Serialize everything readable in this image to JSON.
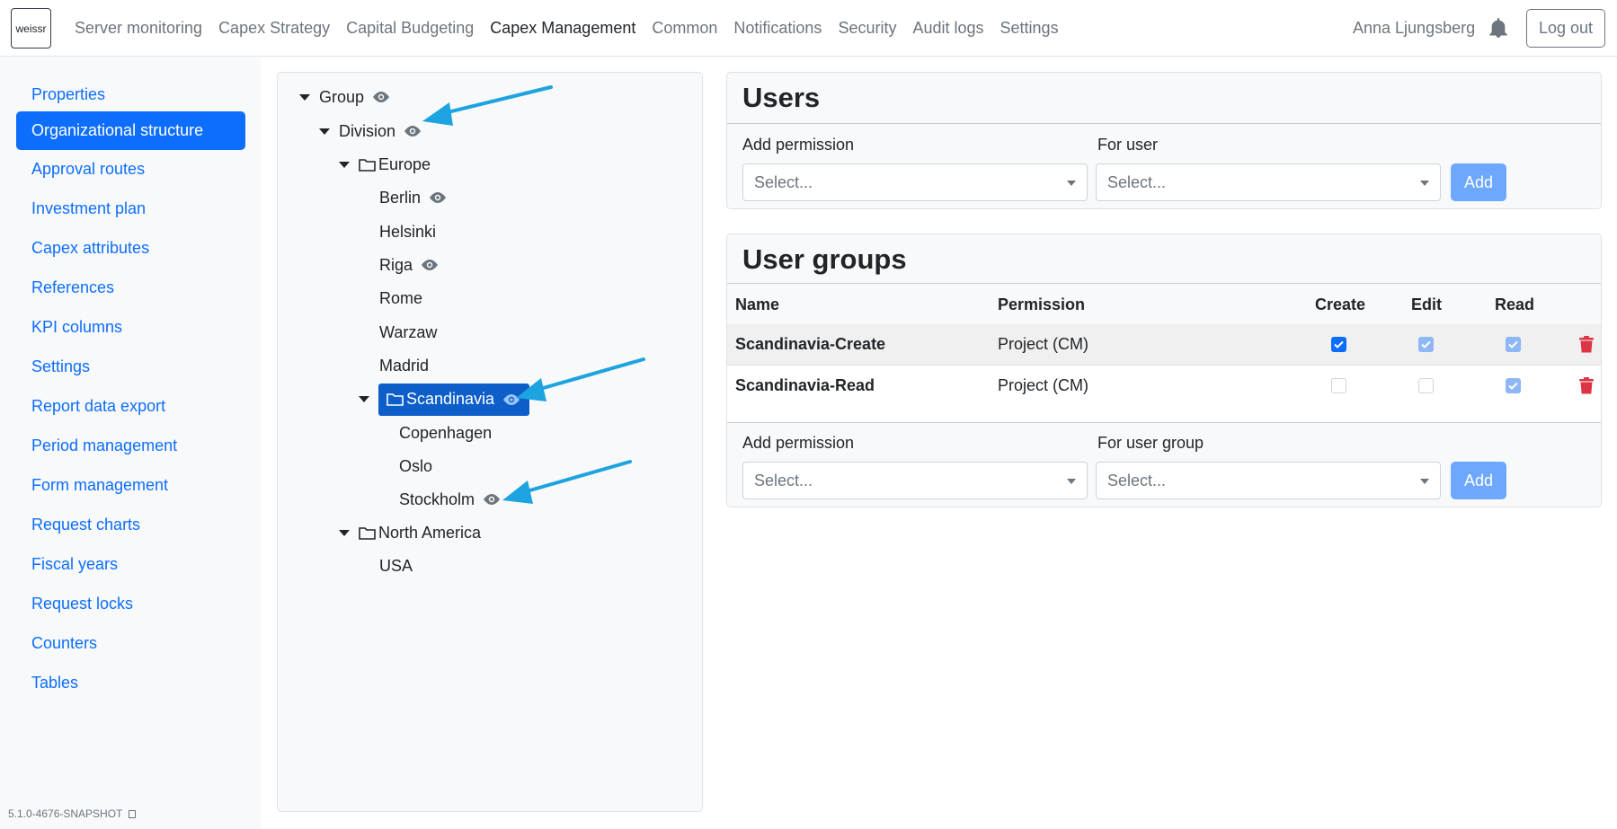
{
  "navbar": {
    "logo": "weissr",
    "items": [
      "Server monitoring",
      "Capex Strategy",
      "Capital Budgeting",
      "Capex Management",
      "Common",
      "Notifications",
      "Security",
      "Audit logs",
      "Settings"
    ],
    "active": "Capex Management",
    "user_name": "Anna Ljungsberg",
    "logout_label": "Log out"
  },
  "sidebar": {
    "items": [
      "Properties",
      "Organizational structure",
      "Approval routes",
      "Investment plan",
      "Capex attributes",
      "References",
      "KPI columns",
      "Settings",
      "Report data export",
      "Period management",
      "Form management",
      "Request charts",
      "Fiscal years",
      "Request locks",
      "Counters",
      "Tables"
    ],
    "active": "Organizational structure",
    "version": "5.1.0-4676-SNAPSHOT"
  },
  "tree": {
    "nodes": [
      {
        "label": "Group",
        "expanded": true,
        "folder": false,
        "eye": true
      },
      {
        "label": "Division",
        "expanded": true,
        "folder": false,
        "eye": true
      },
      {
        "label": "Europe",
        "expanded": true,
        "folder": true,
        "eye": false
      },
      {
        "label": "Berlin",
        "folder": false,
        "eye": true
      },
      {
        "label": "Helsinki",
        "folder": false,
        "eye": false
      },
      {
        "label": "Riga",
        "folder": false,
        "eye": true
      },
      {
        "label": "Rome",
        "folder": false,
        "eye": false
      },
      {
        "label": "Warzaw",
        "folder": false,
        "eye": false
      },
      {
        "label": "Madrid",
        "folder": false,
        "eye": false
      },
      {
        "label": "Scandinavia",
        "expanded": true,
        "folder": true,
        "eye": true,
        "selected": true
      },
      {
        "label": "Copenhagen",
        "folder": false,
        "eye": false
      },
      {
        "label": "Oslo",
        "folder": false,
        "eye": false
      },
      {
        "label": "Stockholm",
        "folder": false,
        "eye": true
      },
      {
        "label": "North America",
        "expanded": true,
        "folder": true,
        "eye": false
      },
      {
        "label": "USA",
        "folder": false,
        "eye": false
      }
    ]
  },
  "users_card": {
    "title": "Users",
    "add_permission_label": "Add permission",
    "for_user_label": "For user",
    "permission_placeholder": "Select...",
    "user_placeholder": "Select...",
    "add_label": "Add"
  },
  "groups_card": {
    "title": "User groups",
    "columns": {
      "name": "Name",
      "permission": "Permission",
      "create": "Create",
      "edit": "Edit",
      "read": "Read"
    },
    "rows": [
      {
        "name": "Scandinavia-Create",
        "permission": "Project (CM)",
        "create": true,
        "edit": true,
        "read": true
      },
      {
        "name": "Scandinavia-Read",
        "permission": "Project (CM)",
        "create": false,
        "edit": false,
        "read": true
      }
    ],
    "add_permission_label": "Add permission",
    "for_group_label": "For user group",
    "permission_placeholder": "Select...",
    "group_placeholder": "Select...",
    "add_label": "Add"
  },
  "colors": {
    "primary": "#0d6efd",
    "selected_node": "#0d5ec9",
    "add_button": "#6ea8fe",
    "arrow": "#1ca3e0",
    "danger": "#dc3545"
  }
}
